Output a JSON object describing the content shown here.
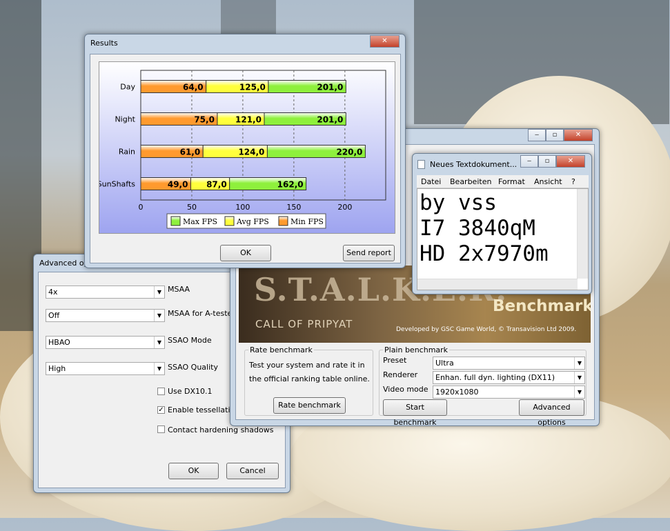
{
  "results": {
    "title": "Results",
    "ok_label": "OK",
    "send_report_label": "Send report",
    "chart_data": {
      "type": "bar",
      "orientation": "horizontal",
      "stacked": true,
      "categories": [
        "Day",
        "Night",
        "Rain",
        "SunShafts"
      ],
      "series": [
        {
          "name": "Min FPS",
          "values": [
            64.0,
            75.0,
            61.0,
            49.0
          ],
          "color": "#ff9a2e"
        },
        {
          "name": "Avg FPS",
          "values": [
            125.0,
            121.0,
            124.0,
            87.0
          ],
          "color": "#ffff3c"
        },
        {
          "name": "Max FPS",
          "values": [
            201.0,
            201.0,
            220.0,
            162.0
          ],
          "color": "#8ef03c"
        }
      ],
      "value_labels": [
        [
          "64,0",
          "125,0",
          "201,0"
        ],
        [
          "75,0",
          "121,0",
          "201,0"
        ],
        [
          "61,0",
          "124,0",
          "220,0"
        ],
        [
          "49,0",
          "87,0",
          "162,0"
        ]
      ],
      "xticks": [
        "0",
        "50",
        "100",
        "150",
        "200"
      ],
      "xlim": [
        0,
        240
      ],
      "legend": [
        "Max FPS",
        "Avg FPS",
        "Min FPS"
      ],
      "legend_position": "bottom"
    }
  },
  "notepad": {
    "title": "Neues Textdokument...",
    "menu": [
      "Datei",
      "Bearbeiten",
      "Format",
      "Ansicht",
      "?"
    ],
    "lines": [
      "by vss",
      "I7 3840qM",
      "HD 2x7970m"
    ]
  },
  "launcher": {
    "logo_text": "S.T.A.L.K.E.R.",
    "subtitle": "CALL OF PRIPYAT",
    "benchmark_label": "Benchmark",
    "credit": "Developed by GSC Game World, © Transavision Ltd 2009.",
    "rate_group": "Rate benchmark",
    "rate_text": "Test your system and rate it in the official ranking table online.",
    "rate_button": "Rate benchmark",
    "plain_group": "Plain benchmark",
    "preset_label": "Preset",
    "preset_value": "Ultra",
    "renderer_label": "Renderer",
    "renderer_value": "Enhan. full dyn. lighting (DX11)",
    "video_label": "Video mode",
    "video_value": "1920x1080",
    "start_button": "Start benchmark",
    "advanced_button": "Advanced options"
  },
  "advanced": {
    "title": "Advanced op",
    "msaa_value": "4x",
    "msaa_label": "MSAA",
    "msaa_at_value": "Off",
    "msaa_at_label": "MSAA for A-tested",
    "ssao_mode_value": "HBAO",
    "ssao_mode_label": "SSAO Mode",
    "ssao_quality_value": "High",
    "ssao_quality_label": "SSAO Quality",
    "dx101_label": "Use DX10.1",
    "tess_label": "Enable tessellation",
    "contact_label": "Contact hardening shadows",
    "ok_label": "OK",
    "cancel_label": "Cancel"
  }
}
